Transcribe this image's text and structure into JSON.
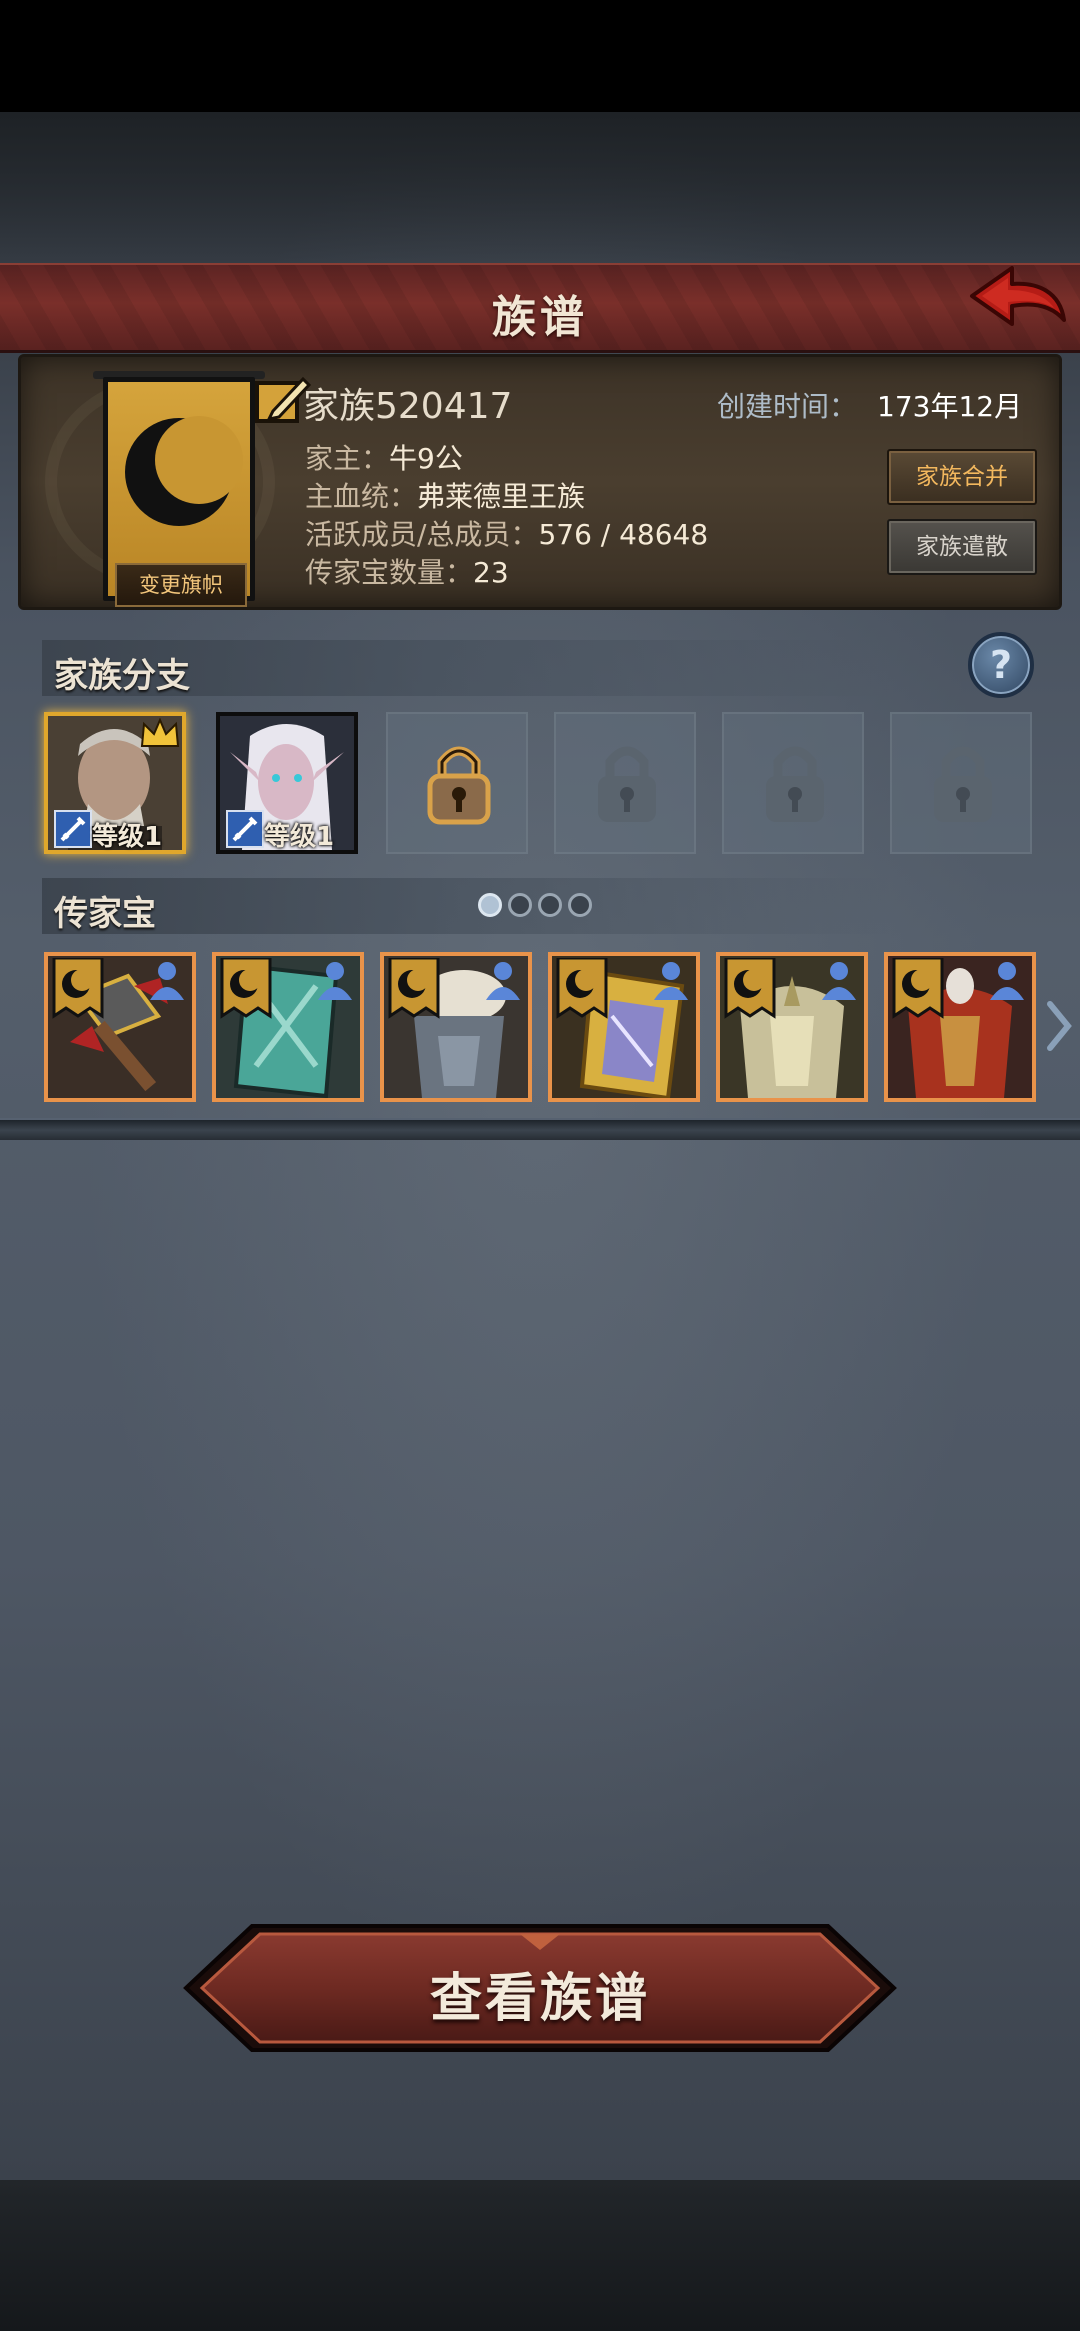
{
  "header": {
    "title": "族谱"
  },
  "family": {
    "name": "家族520417",
    "created_label": "创建时间：",
    "created_value": "173年12月",
    "leader_label": "家主：",
    "leader_value": "牛9公",
    "bloodline_label": "主血统：",
    "bloodline_value": "弗莱德里王族",
    "members_label": "活跃成员/总成员：",
    "members_value": "576 / 48648",
    "heirloom_count_label": "传家宝数量：",
    "heirloom_count_value": "23",
    "change_banner_label": "变更旗帜",
    "merge_label": "家族合并",
    "disband_label": "家族遣散"
  },
  "branches": {
    "title": "家族分支",
    "help_icon": "question-mark-icon",
    "slots": [
      {
        "state": "member",
        "portrait": "old-warrior-portrait",
        "class_icon": "sword-icon",
        "level": "等级1",
        "selected": true,
        "crown": true
      },
      {
        "state": "member",
        "portrait": "elf-woman-portrait",
        "class_icon": "sword-icon",
        "level": "等级1",
        "selected": false
      },
      {
        "state": "locked-unlockable",
        "icon": "padlock-icon"
      },
      {
        "state": "locked",
        "icon": "padlock-icon"
      },
      {
        "state": "locked",
        "icon": "padlock-icon"
      },
      {
        "state": "locked",
        "icon": "padlock-icon"
      }
    ]
  },
  "heirlooms": {
    "title": "传家宝",
    "pages": 4,
    "current_page": 1,
    "items": [
      {
        "name": "warhammer",
        "icon": "warhammer-icon"
      },
      {
        "name": "jade-shield",
        "icon": "ornate-shield-icon"
      },
      {
        "name": "steel-armor",
        "icon": "plate-armor-icon"
      },
      {
        "name": "golden-shield",
        "icon": "golden-shield-icon"
      },
      {
        "name": "gold-armor",
        "icon": "gold-armor-icon"
      },
      {
        "name": "crimson-armor",
        "icon": "crimson-armor-icon"
      }
    ]
  },
  "actions": {
    "view_tree_label": "查看族谱"
  },
  "colors": {
    "accent_gold": "#e0a72c",
    "title_red": "#7a2f2a",
    "item_border": "#e9934a"
  }
}
